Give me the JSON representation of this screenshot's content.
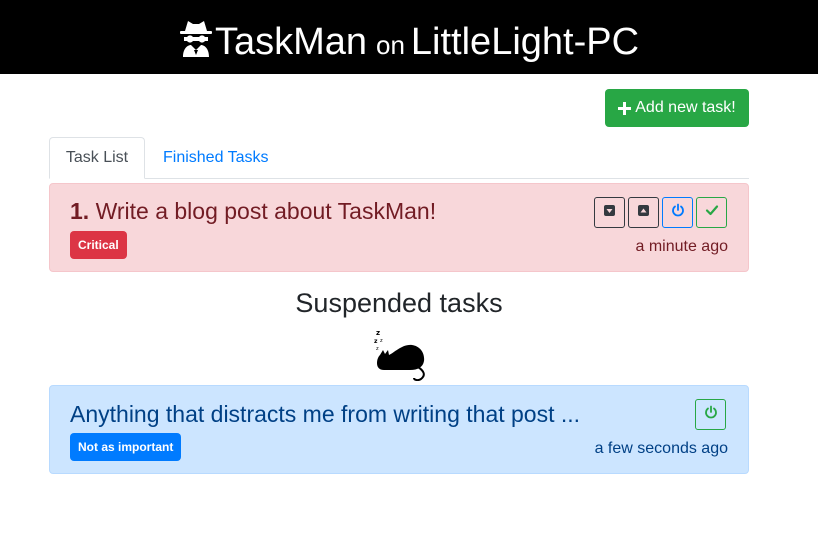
{
  "header": {
    "app_name": "TaskMan",
    "connector": "on",
    "host": "LittleLight-PC",
    "icon": "spy-icon"
  },
  "toolbar": {
    "add_task_label": "Add new task!",
    "add_icon": "plus-icon"
  },
  "tabs": [
    {
      "label": "Task List",
      "active": true
    },
    {
      "label": "Finished Tasks",
      "active": false
    }
  ],
  "active_tasks": [
    {
      "number": "1.",
      "title": "Write a blog post about TaskMan!",
      "badge": "Critical",
      "time": "a minute ago",
      "actions": [
        "move-down-icon",
        "move-up-icon",
        "suspend-icon",
        "check-icon"
      ]
    }
  ],
  "suspended": {
    "heading": "Suspended tasks",
    "illustration": "sleeping-cat-icon",
    "tasks": [
      {
        "title": "Anything that distracts me from writing that post ...",
        "badge": "Not as important",
        "time": "a few seconds ago",
        "actions": [
          "resume-icon"
        ]
      }
    ]
  },
  "colors": {
    "header_bg": "#000000",
    "success": "#28a745",
    "primary": "#007bff",
    "danger": "#dc3545",
    "danger_bg": "#f8d7da",
    "info_bg": "#cce5ff"
  }
}
